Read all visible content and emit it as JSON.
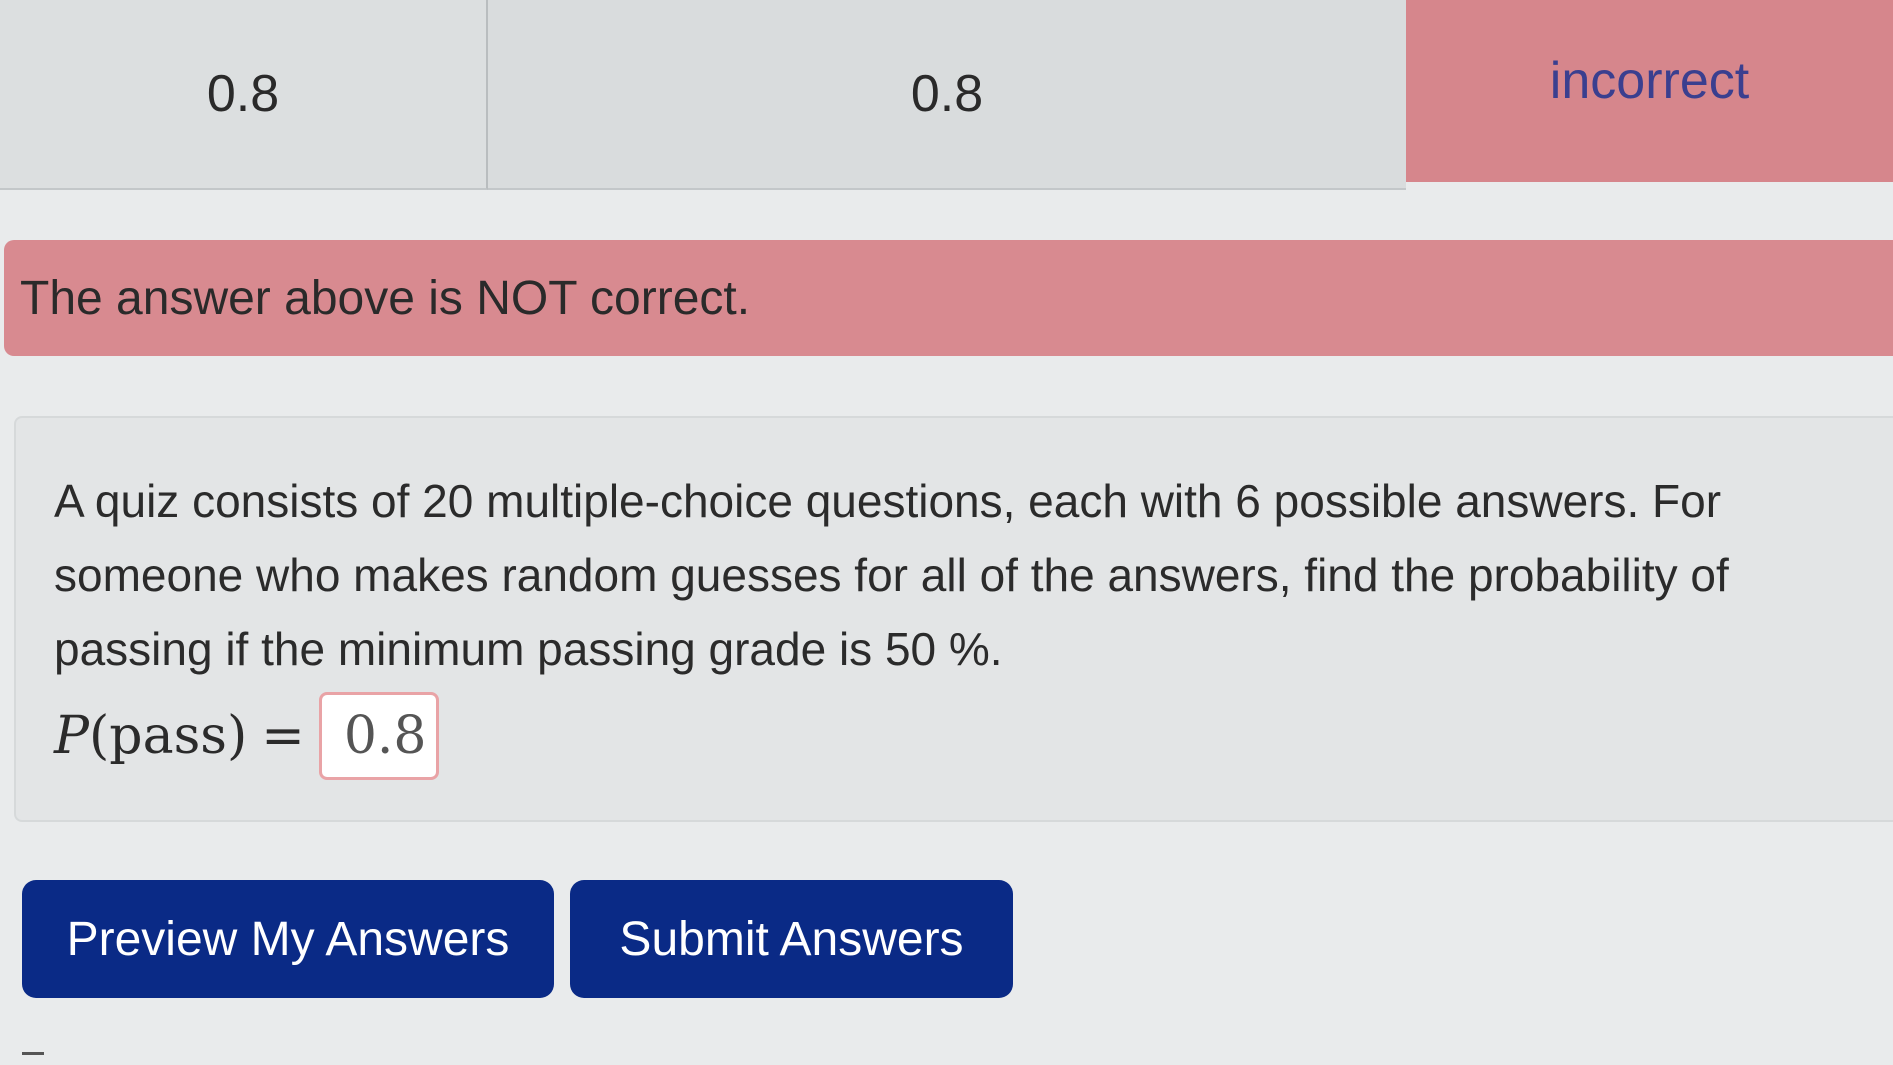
{
  "results": {
    "entered": "0.8",
    "preview": "0.8",
    "result": "incorrect"
  },
  "alert": {
    "message": "The answer above is NOT correct."
  },
  "problem": {
    "text": "A quiz consists of 20 multiple-choice questions, each with 6 possible answers. For someone who makes random guesses for all of the answers, find the probability of passing if the minimum passing grade is 50 %.",
    "answer_label_var": "P",
    "answer_label_arg": "(pass)",
    "answer_label_eq": "=",
    "answer_value": "0.8"
  },
  "buttons": {
    "preview_label": "Preview My Answers",
    "submit_label": "Submit Answers"
  },
  "colors": {
    "incorrect_bg": "#d6868c",
    "button_bg": "#0a2a86",
    "result_text": "#3a3f8f"
  }
}
